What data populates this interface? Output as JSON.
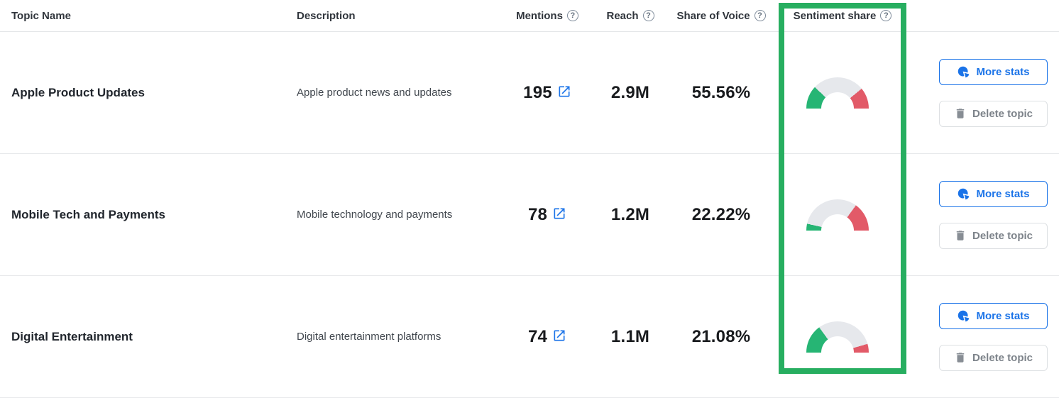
{
  "table": {
    "columns": [
      {
        "label": "Topic Name",
        "help": false
      },
      {
        "label": "Description",
        "help": false
      },
      {
        "label": "Mentions",
        "help": true
      },
      {
        "label": "Reach",
        "help": true
      },
      {
        "label": "Share of Voice",
        "help": true
      },
      {
        "label": "Sentiment share",
        "help": true
      }
    ],
    "rows": [
      {
        "topic": "Apple Product Updates",
        "description": "Apple product news and updates",
        "mentions": "195",
        "reach": "2.9M",
        "share_of_voice": "55.56%",
        "sentiment": {
          "positive": 24,
          "neutral": 54,
          "negative": 22
        }
      },
      {
        "topic": "Mobile Tech and Payments",
        "description": "Mobile technology and payments",
        "mentions": "78",
        "reach": "1.2M",
        "share_of_voice": "22.22%",
        "sentiment": {
          "positive": 7,
          "neutral": 63,
          "negative": 30
        }
      },
      {
        "topic": "Digital Entertainment",
        "description": "Digital entertainment platforms",
        "mentions": "74",
        "reach": "1.1M",
        "share_of_voice": "21.08%",
        "sentiment": {
          "positive": 30,
          "neutral": 61,
          "negative": 9
        }
      }
    ]
  },
  "buttons": {
    "more_stats": "More stats",
    "delete_topic": "Delete topic"
  },
  "help_glyph": "?",
  "highlighted_column": "Sentiment share",
  "colors": {
    "positive": "#26b574",
    "neutral": "#e6e8ec",
    "negative": "#e25a68",
    "highlight_border": "#27ae60",
    "accent_blue": "#1a73e8"
  }
}
